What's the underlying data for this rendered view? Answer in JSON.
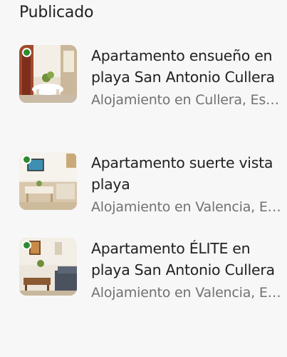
{
  "section": {
    "title": "Publicado"
  },
  "listings": [
    {
      "title": "Apartamento ensueño en playa San Antonio Cullera",
      "subtitle": "Alojamiento en Cullera, España",
      "status_color": "#2e8b2e"
    },
    {
      "title": "Apartamento suerte vista playa",
      "subtitle": "Alojamiento en Valencia, España",
      "status_color": "#2e8b2e"
    },
    {
      "title": "Apartamento ÉLITE en playa San Antonio Cullera",
      "subtitle": "Alojamiento en Valencia, España",
      "status_color": "#2e8b2e"
    }
  ]
}
